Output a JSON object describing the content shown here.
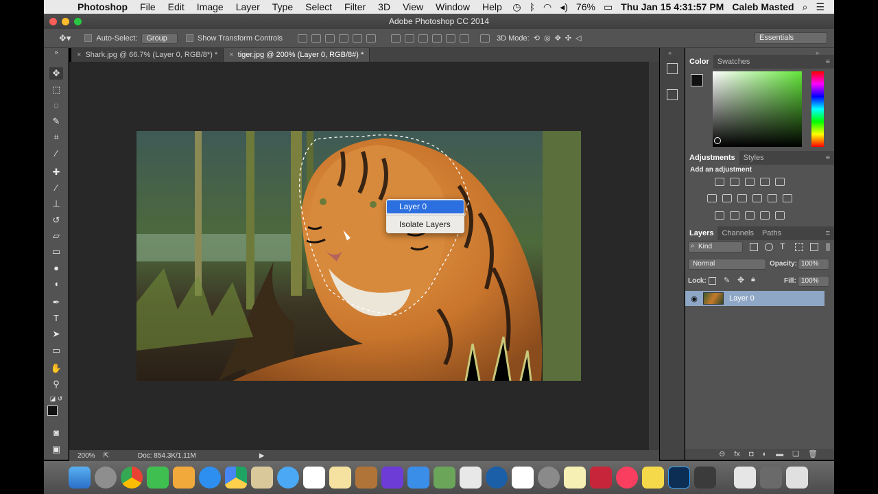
{
  "menubar": {
    "app_name": "Photoshop",
    "items": [
      "File",
      "Edit",
      "Image",
      "Layer",
      "Type",
      "Select",
      "Filter",
      "3D",
      "View",
      "Window",
      "Help"
    ],
    "battery": "76%",
    "datetime": "Thu Jan 15  4:31:57 PM",
    "user": "Caleb Masted"
  },
  "window": {
    "title": "Adobe Photoshop CC 2014"
  },
  "options": {
    "auto_select_label": "Auto-Select:",
    "auto_select_value": "Group",
    "transform_label": "Show Transform Controls",
    "mode_label": "3D Mode:",
    "workspace": "Essentials"
  },
  "tabs": [
    {
      "label": "Shark.jpg @ 66.7% (Layer 0, RGB/8*) *",
      "close": "×"
    },
    {
      "label": "tiger.jpg @ 200% (Layer 0, RGB/8#) *",
      "close": "×"
    }
  ],
  "context_menu": {
    "items": [
      "Layer 0",
      "Isolate Layers"
    ]
  },
  "status": {
    "zoom": "200%",
    "doc": "Doc: 854.3K/1.11M"
  },
  "color_panel": {
    "tabs": [
      "Color",
      "Swatches"
    ]
  },
  "adjustments_panel": {
    "tabs": [
      "Adjustments",
      "Styles"
    ],
    "hint": "Add an adjustment"
  },
  "layers_panel": {
    "tabs": [
      "Layers",
      "Channels",
      "Paths"
    ],
    "filter_kind": "Kind",
    "blend_mode": "Normal",
    "opacity_label": "Opacity:",
    "opacity_value": "100%",
    "lock_label": "Lock:",
    "fill_label": "Fill:",
    "fill_value": "100%",
    "layers": [
      {
        "name": "Layer 0"
      }
    ]
  },
  "colors": {
    "highlight": "#2c6fe0",
    "layer_selected": "#8fa7c6",
    "panel_bg": "#535353"
  }
}
